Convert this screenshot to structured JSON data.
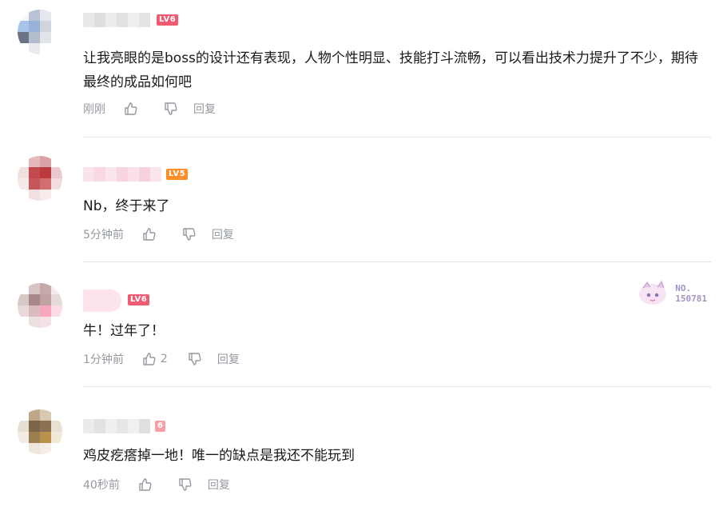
{
  "comments": [
    {
      "level": "LV6",
      "level_color": "#f05b72",
      "text": "让我亮眼的是boss的设计还有表现，人物个性明显、技能打斗流畅，可以看出技术力提升了不少，期待最终的成品如何吧",
      "time": "刚刚",
      "likes": "",
      "reply": "回复"
    },
    {
      "level": "LV5",
      "level_color": "#ff8e29",
      "text": "Nb，终于来了",
      "time": "5分钟前",
      "likes": "",
      "reply": "回复"
    },
    {
      "level": "LV6",
      "level_color": "#f05b72",
      "text": "牛！过年了！",
      "time": "1分钟前",
      "likes": "2",
      "reply": "回复",
      "badge_no": "NO.",
      "badge_number": "150781"
    },
    {
      "level": "6",
      "level_color": "#f6a0a6",
      "text": "鸡皮疙瘩掉一地！唯一的缺点是我还不能玩到",
      "time": "40秒前",
      "likes": "",
      "reply": "回复"
    }
  ],
  "icons": {
    "like": "thumb-up-icon",
    "dislike": "thumb-down-icon"
  },
  "colors": {
    "meta_text": "#9499a0",
    "body_text": "#18191c",
    "divider": "#e3e5e7"
  }
}
